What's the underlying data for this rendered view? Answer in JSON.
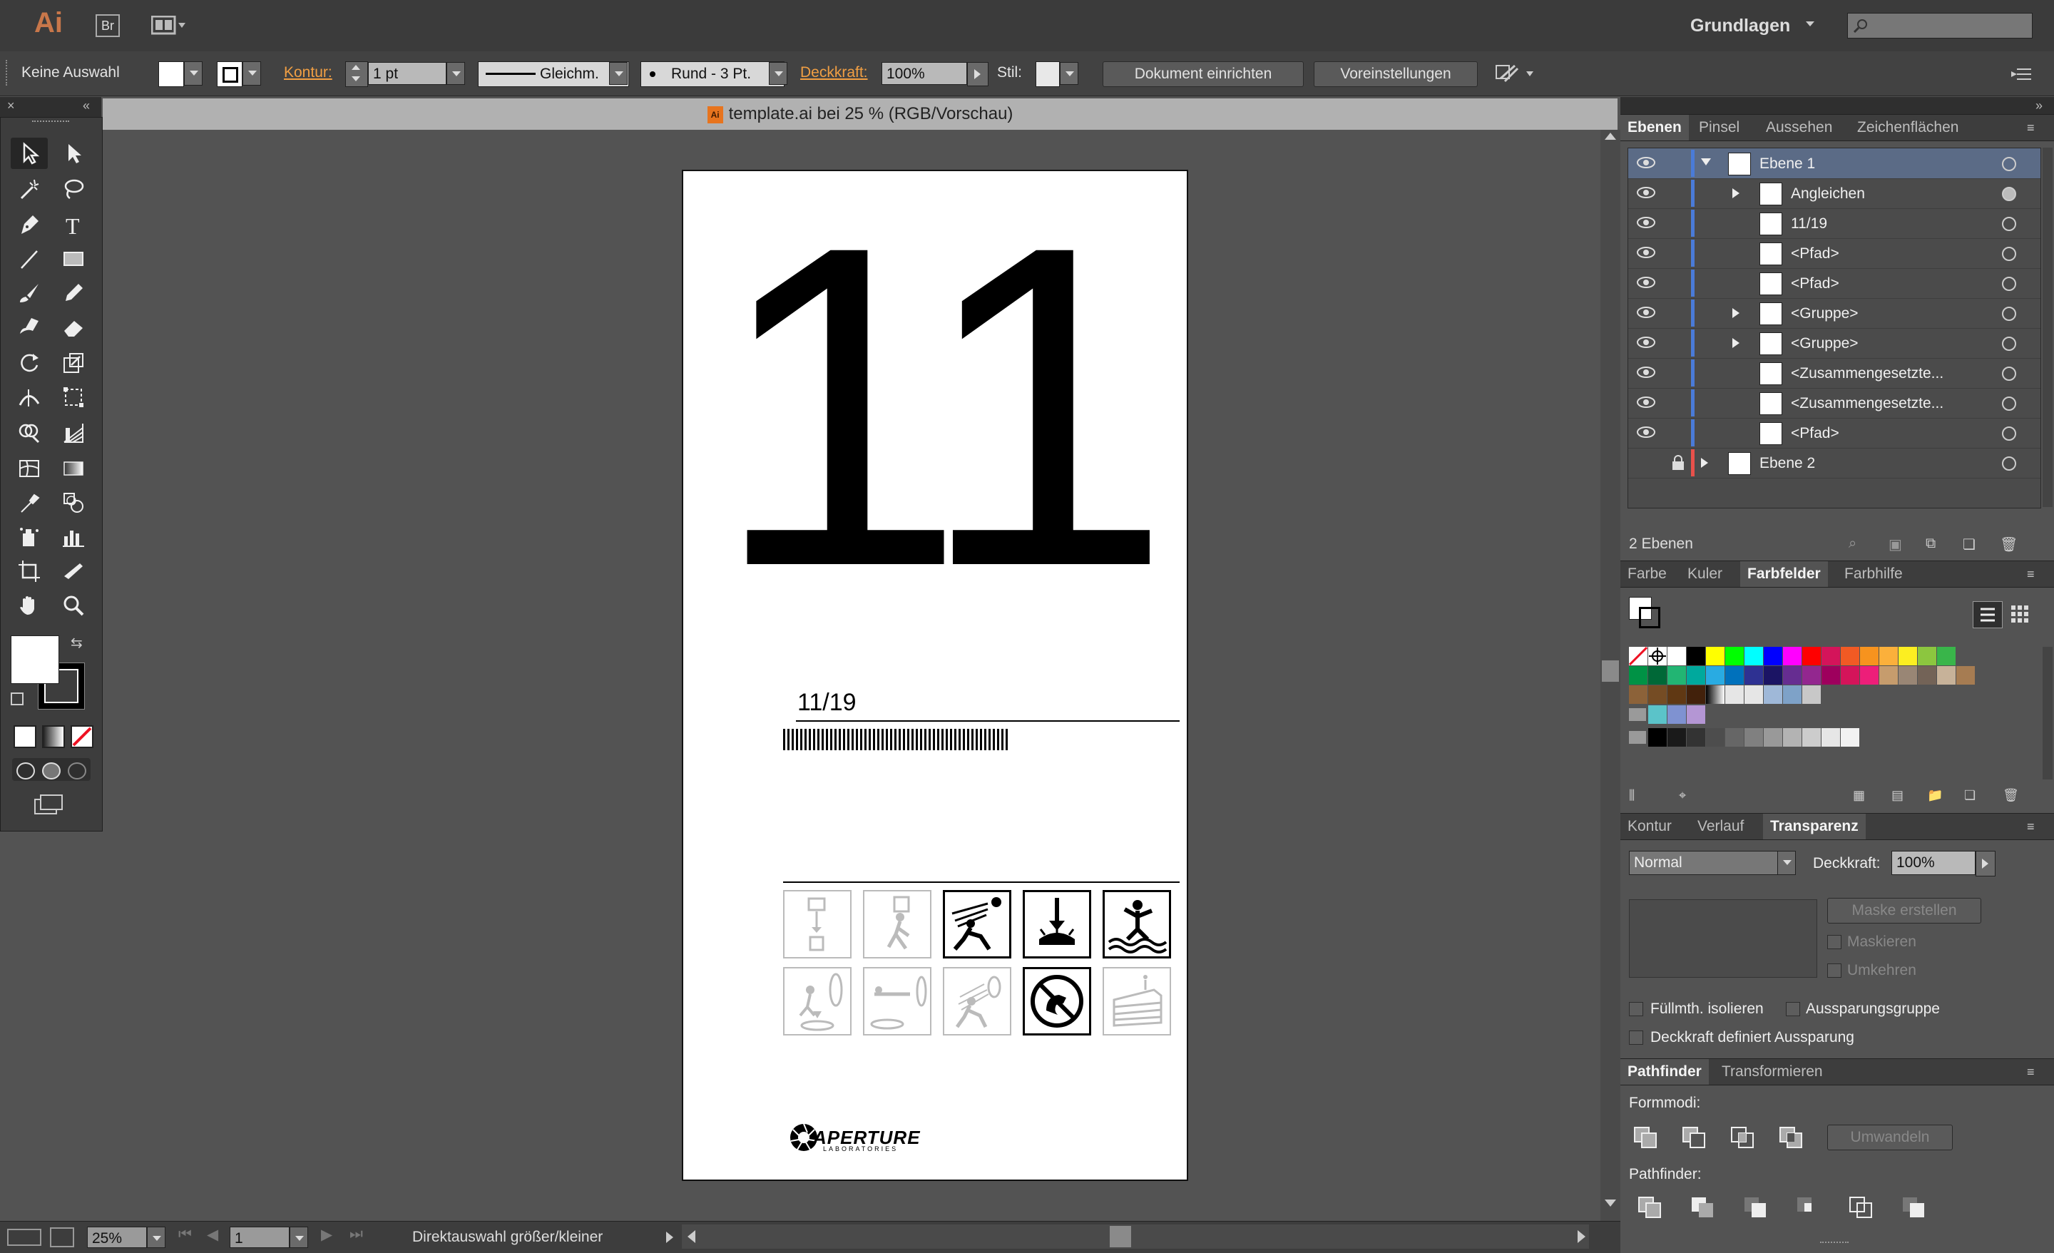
{
  "app": {
    "logo": "Ai",
    "bridge": "Br",
    "workspace": "Grundlagen",
    "search_placeholder": ""
  },
  "control": {
    "selection": "Keine Auswahl",
    "stroke_label": "Kontur:",
    "stroke_value": "1 pt",
    "stroke_profile": "Gleichm.",
    "brush": "Rund - 3 Pt.",
    "opacity_label": "Deckkraft:",
    "opacity_value": "100%",
    "style_label": "Stil:",
    "doc_setup": "Dokument einrichten",
    "preferences": "Voreinstellungen"
  },
  "document": {
    "tab_title": "template.ai bei 25 % (RGB/Vorschau)",
    "big_number": "11",
    "fraction": "11/19",
    "brand_main": "APERTURE",
    "brand_sub": "LABORATORIES"
  },
  "layers_panel": {
    "tabs": [
      "Ebenen",
      "Pinsel",
      "Aussehen",
      "Zeichenflächen"
    ],
    "rows": [
      {
        "name": "Ebene 1",
        "level": 0,
        "expanded": true
      },
      {
        "name": "Angleichen",
        "level": 1,
        "expandable": true
      },
      {
        "name": "11/19",
        "level": 1,
        "expandable": false
      },
      {
        "name": "<Pfad>",
        "level": 1
      },
      {
        "name": "<Pfad>",
        "level": 1
      },
      {
        "name": "<Gruppe>",
        "level": 1,
        "expandable": true
      },
      {
        "name": "<Gruppe>",
        "level": 1,
        "expandable": true
      },
      {
        "name": "<Zusammengesetzte...",
        "level": 1
      },
      {
        "name": "<Zusammengesetzte...",
        "level": 1
      },
      {
        "name": "<Pfad>",
        "level": 1
      },
      {
        "name": "Ebene 2",
        "level": 0,
        "locked": true
      }
    ],
    "footer": "2 Ebenen"
  },
  "swatches_panel": {
    "tabs": [
      "Farbe",
      "Kuler",
      "Farbfelder",
      "Farbhilfe"
    ],
    "row1": [
      "#000000",
      "#ffff00",
      "#00ff00",
      "#00ffff",
      "#0000ff",
      "#ff00ff",
      "#ff0000",
      "#d4145a",
      "#f15a24",
      "#f7931e",
      "#fbb03b",
      "#fcee21",
      "#8cc63f",
      "#39b54a"
    ],
    "row2": [
      "#009245",
      "#006837",
      "#22b573",
      "#00a99d",
      "#29abe2",
      "#0071bc",
      "#2e3192",
      "#1b1464",
      "#662d91",
      "#93278f",
      "#9e005d",
      "#d4145a",
      "#ed1e79",
      "#c69c6d",
      "#998675",
      "#736357",
      "#c7b299",
      "#a67c52"
    ],
    "row3": [
      "#8c6239",
      "#754c24",
      "#603813",
      "#42210b"
    ],
    "row4": [
      "#5bc3c9",
      "#7f92d1",
      "#b496d4"
    ],
    "grays": [
      "#000000",
      "#1a1a1a",
      "#333333",
      "#4d4d4d",
      "#666666",
      "#808080",
      "#999999",
      "#b3b3b3",
      "#cccccc",
      "#e6e6e6",
      "#f2f2f2"
    ]
  },
  "transparency_panel": {
    "tabs": [
      "Kontur",
      "Verlauf",
      "Transparenz"
    ],
    "blend": "Normal",
    "opacity_label": "Deckkraft:",
    "opacity_value": "100%",
    "make_mask": "Maske erstellen",
    "clip": "Maskieren",
    "invert": "Umkehren",
    "isolate": "Füllmth. isolieren",
    "knockout": "Aussparungsgruppe",
    "opacity_knockout": "Deckkraft definiert Aussparung"
  },
  "pathfinder_panel": {
    "tabs": [
      "Pathfinder",
      "Transformieren"
    ],
    "shape_modes": "Formmodi:",
    "expand": "Umwandeln",
    "pathfinders": "Pathfinder:"
  },
  "status": {
    "zoom": "25%",
    "page": "1",
    "status_text": "Direktauswahl größer/kleiner"
  }
}
